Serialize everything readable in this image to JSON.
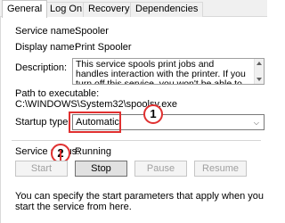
{
  "tabs": [
    {
      "label": "General"
    },
    {
      "label": "Log On"
    },
    {
      "label": "Recovery"
    },
    {
      "label": "Dependencies"
    }
  ],
  "service": {
    "name_label": "Service name:",
    "name_value": "Spooler",
    "display_label": "Display name:",
    "display_value": "Print Spooler",
    "description_label": "Description:",
    "description_value": "This service spools print jobs and handles interaction with the printer.  If you turn off this service, you won't be able to print or see your printers.",
    "path_label": "Path to executable:",
    "path_value": "C:\\WINDOWS\\System32\\spoolsv.exe",
    "startup_label": "Startup type:",
    "startup_value": "Automatic",
    "status_label": "Service status:",
    "status_value": "Running"
  },
  "buttons": {
    "start": "Start",
    "stop": "Stop",
    "pause": "Pause",
    "resume": "Resume"
  },
  "callouts": {
    "one": "1",
    "two": "2"
  },
  "footer_text": "You can specify the start parameters that apply when you start the service from here.",
  "colors": {
    "annotation_red": "#e03030",
    "disabled_text": "#a0a0a0"
  }
}
